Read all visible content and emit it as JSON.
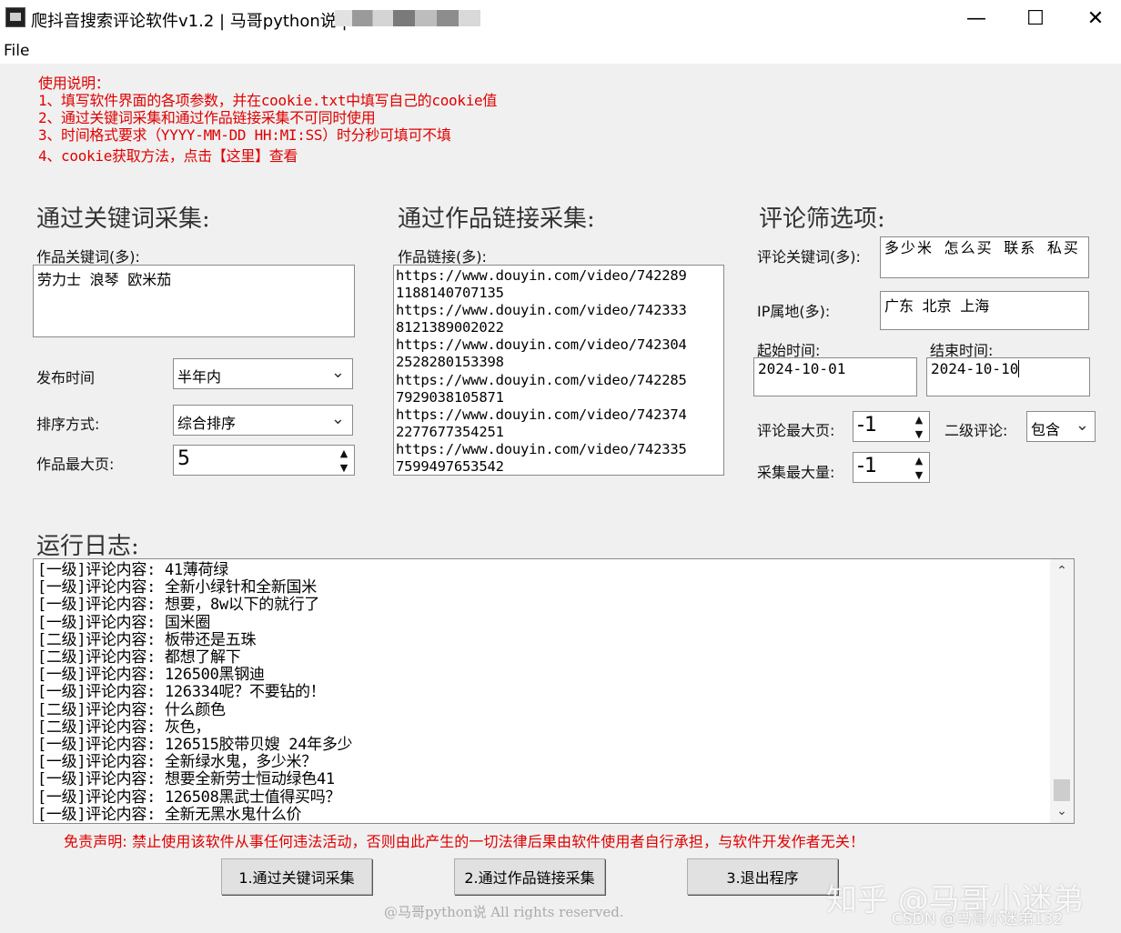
{
  "window": {
    "title": "爬抖音搜索评论软件v1.2 | 马哥python说 |",
    "minimize": "—",
    "maximize": "☐",
    "close": "✕"
  },
  "menu": {
    "file": "File"
  },
  "instructions": [
    "使用说明：",
    "1、填写软件界面的各项参数，并在cookie.txt中填写自己的cookie值",
    "2、通过关键词采集和通过作品链接采集不可同时使用",
    "3、时间格式要求（YYYY-MM-DD HH:MI:SS）时分秒可填可不填",
    "4、cookie获取方法，点击【这里】查看"
  ],
  "keyword_section": {
    "title": "通过关键词采集:",
    "keywords_label": "作品关键词(多):",
    "keywords_value": "劳力士 浪琴 欧米茄",
    "publish_time_label": "发布时间",
    "publish_time_value": "半年内",
    "sort_label": "排序方式:",
    "sort_value": "综合排序",
    "max_page_label": "作品最大页:",
    "max_page_value": "5"
  },
  "link_section": {
    "title": "通过作品链接采集:",
    "links_label": "作品链接(多):",
    "links": [
      "https://www.douyin.com/video/742289",
      "1188140707135",
      "https://www.douyin.com/video/742333",
      "8121389002022",
      "https://www.douyin.com/video/742304",
      "2528280153398",
      "https://www.douyin.com/video/742285",
      "7929038105871",
      "https://www.douyin.com/video/742374",
      "2277677354251",
      "https://www.douyin.com/video/742335",
      "7599497653542"
    ]
  },
  "filter_section": {
    "title": "评论筛选项:",
    "comment_keywords_label": "评论关键词(多):",
    "comment_keywords_value": "多少米 怎么买 联系 私买",
    "ip_label": "IP属地(多):",
    "ip_value": "广东 北京 上海",
    "start_label": "起始时间:",
    "start_value": "2024-10-01",
    "end_label": "结束时间:",
    "end_value": "2024-10-10",
    "max_comment_page_label": "评论最大页:",
    "max_comment_page_value": "-1",
    "second_level_label": "二级评论:",
    "second_level_value": "包含",
    "max_count_label": "采集最大量:",
    "max_count_value": "-1"
  },
  "log": {
    "title": "运行日志:",
    "lines": [
      "[一级]评论内容: 41薄荷绿",
      "[一级]评论内容: 全新小绿针和全新国米",
      "[一级]评论内容: 想要，8w以下的就行了",
      "[一级]评论内容: 国米圈",
      "[二级]评论内容: 板带还是五珠",
      "[二级]评论内容: 都想了解下",
      "[一级]评论内容: 126500黑钢迪",
      "[一级]评论内容: 126334呢？不要钻的！",
      "[二级]评论内容: 什么颜色",
      "[二级]评论内容: 灰色，",
      "[一级]评论内容: 126515胶带贝嫂 24年多少",
      "[一级]评论内容: 全新绿水鬼，多少米？",
      "[一级]评论内容: 想要全新劳士恒动绿色41",
      "[一级]评论内容: 126508黑武士值得买吗？",
      "[一级]评论内容: 全新无黑水鬼什么价"
    ]
  },
  "disclaimer": "免责声明: 禁止使用该软件从事任何违法活动，否则由此产生的一切法律后果由软件使用者自行承担，与软件开发作者无关！",
  "buttons": {
    "keyword_collect": "1.通过关键词采集",
    "link_collect": "2.通过作品链接采集",
    "exit": "3.退出程序"
  },
  "footer": "@马哥python说 All rights reserved.",
  "watermarks": {
    "zhihu": "知乎 @马哥小迷弟",
    "csdn": "CSDN @马哥小迷弟132"
  }
}
